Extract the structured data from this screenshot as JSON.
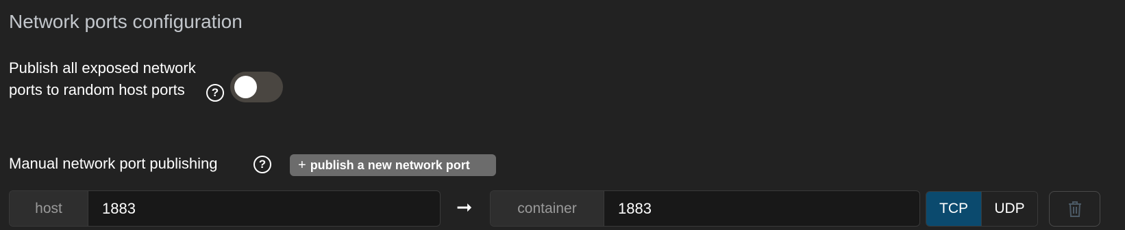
{
  "section": {
    "title": "Network ports configuration"
  },
  "publish_all": {
    "label": "Publish all exposed network ports to random host ports",
    "help_icon": "question-circle-icon",
    "toggle_enabled": false
  },
  "manual": {
    "label": "Manual network port publishing",
    "help_icon": "question-circle-icon",
    "add_button_icon": "+",
    "add_button_label": "publish a new network port"
  },
  "port_mapping": {
    "host_addon": "host",
    "host_value": "1883",
    "arrow": "➞",
    "container_addon": "container",
    "container_value": "1883",
    "protocols": [
      "TCP",
      "UDP"
    ],
    "selected_protocol": "TCP",
    "delete_icon": "trash-icon"
  },
  "colors": {
    "background": "#222222",
    "tcp_selected": "#0b4a6e",
    "toggle_off": "#4a4641",
    "button_gray": "#6c6c6c"
  }
}
